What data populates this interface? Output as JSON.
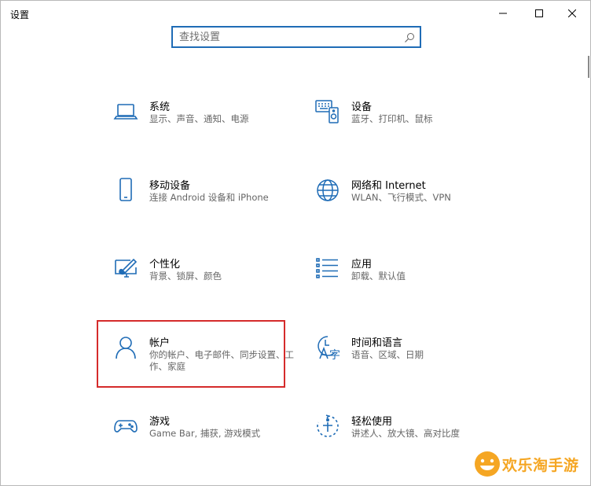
{
  "window": {
    "title": "设置"
  },
  "search": {
    "placeholder": "查找设置"
  },
  "categories": [
    {
      "name": "系统",
      "desc": "显示、声音、通知、电源"
    },
    {
      "name": "设备",
      "desc": "蓝牙、打印机、鼠标"
    },
    {
      "name": "移动设备",
      "desc": "连接 Android 设备和 iPhone"
    },
    {
      "name": "网络和 Internet",
      "desc": "WLAN、飞行模式、VPN"
    },
    {
      "name": "个性化",
      "desc": "背景、锁屏、颜色"
    },
    {
      "name": "应用",
      "desc": "卸载、默认值"
    },
    {
      "name": "帐户",
      "desc": "你的帐户、电子邮件、同步设置、工作、家庭"
    },
    {
      "name": "时间和语言",
      "desc": "语音、区域、日期"
    },
    {
      "name": "游戏",
      "desc": "Game Bar, 捕获, 游戏模式"
    },
    {
      "name": "轻松使用",
      "desc": "讲述人、放大镜、高对比度"
    }
  ],
  "accent_color": "#1f6cb6",
  "highlight_color": "#d52b2b",
  "watermark": {
    "text": "欢乐淘手游"
  }
}
